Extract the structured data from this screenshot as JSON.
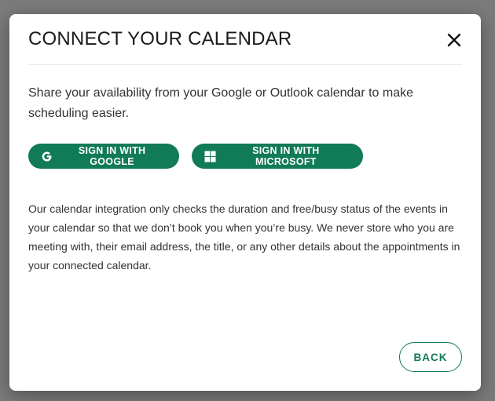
{
  "modal": {
    "title": "CONNECT YOUR CALENDAR",
    "close_icon": "close-icon",
    "intro": "Share your availability from your Google or Outlook calendar to make scheduling easier.",
    "buttons": {
      "google": {
        "label": "SIGN IN WITH GOOGLE",
        "icon": "google-icon"
      },
      "microsoft": {
        "label": "SIGN IN WITH MICROSOFT",
        "icon": "microsoft-icon"
      }
    },
    "disclaimer": "Our calendar integration only checks the duration and free/busy status of the events in your calendar so that we don’t book you when you’re busy. We never store who you are meeting with, their email address, the title, or any other details about the appointments in your connected calendar.",
    "back_label": "BACK"
  },
  "colors": {
    "overlay": "#7b7b7b",
    "accent": "#117a57",
    "text": "#333333",
    "title": "#1a1a1a"
  }
}
